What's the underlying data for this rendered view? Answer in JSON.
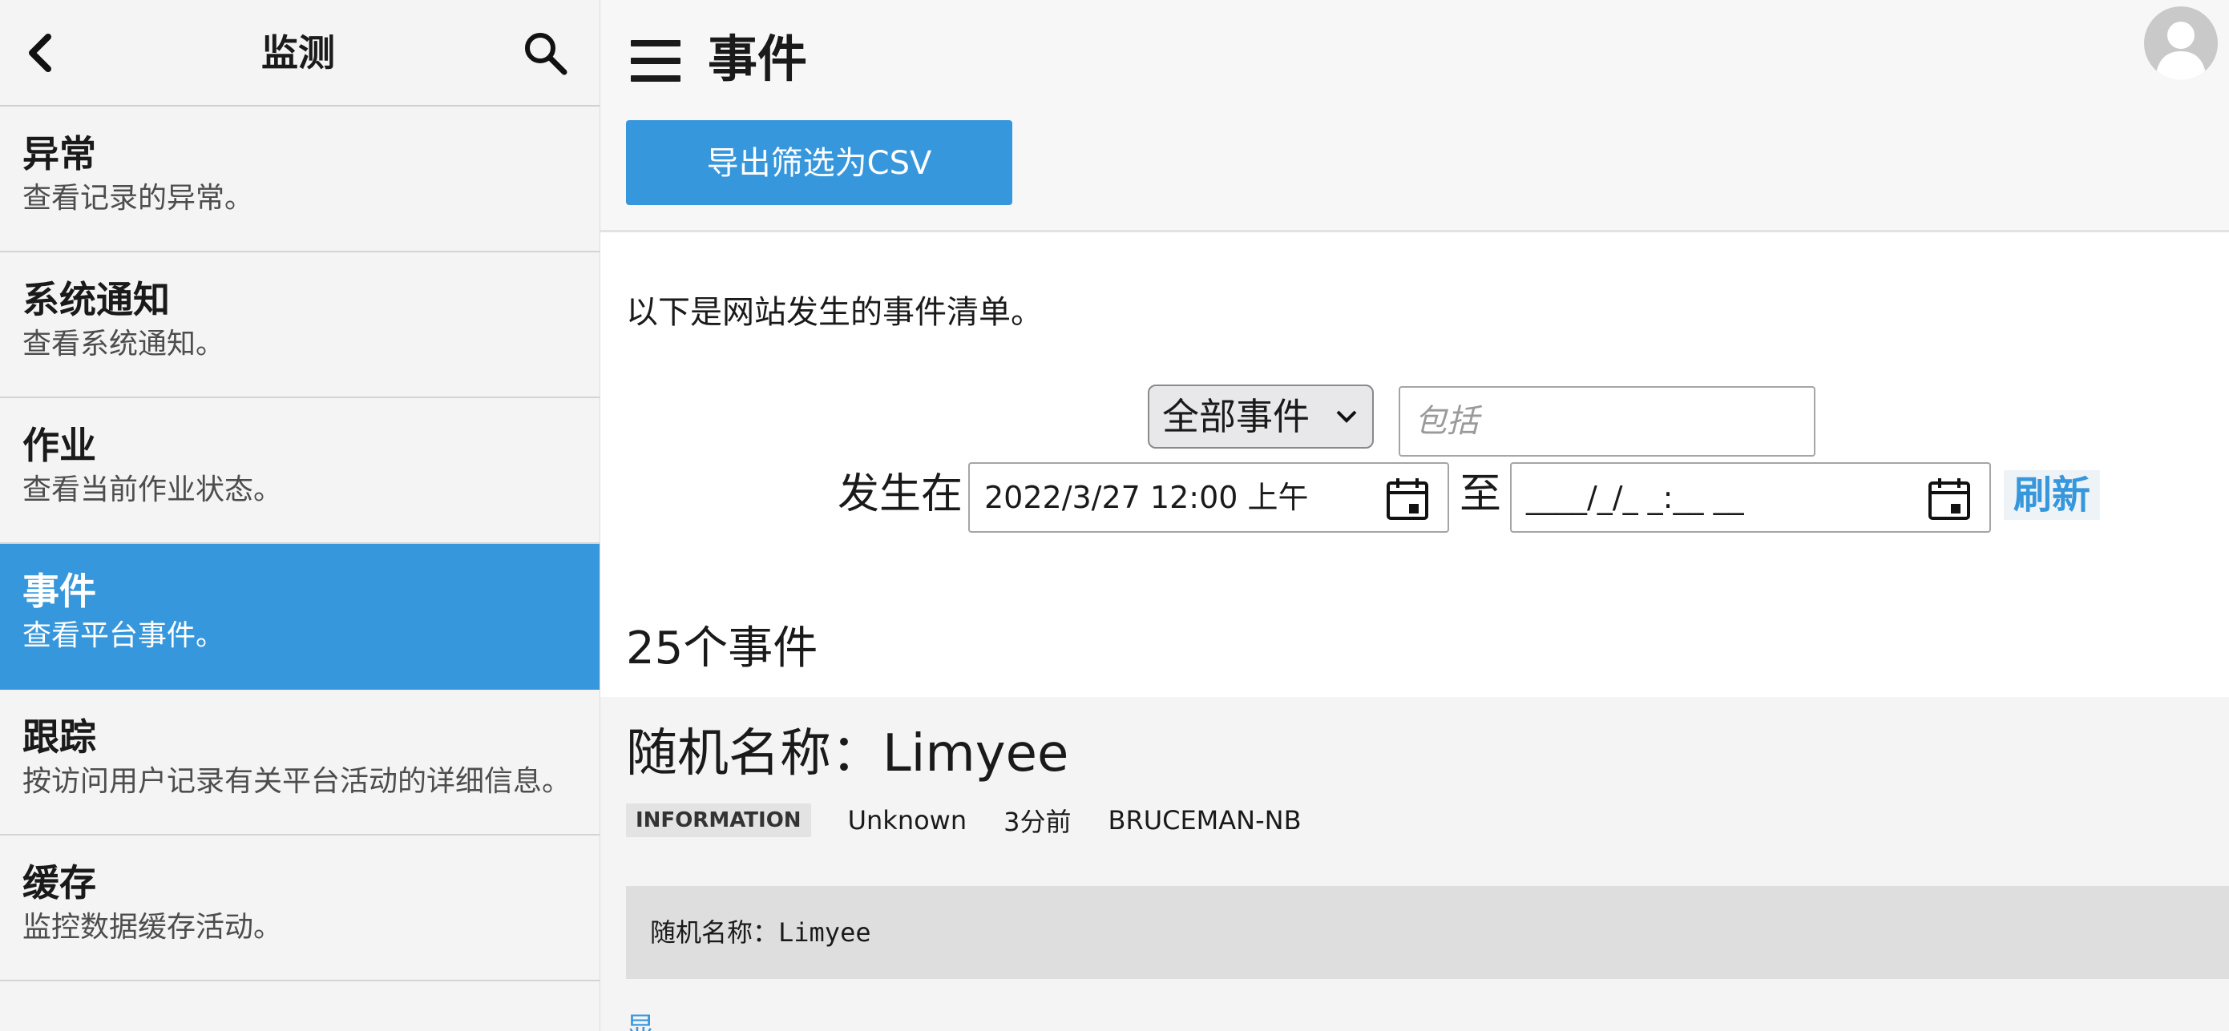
{
  "sidebar": {
    "title": "监测",
    "items": [
      {
        "title": "异常",
        "desc": "查看记录的异常。"
      },
      {
        "title": "系统通知",
        "desc": "查看系统通知。"
      },
      {
        "title": "作业",
        "desc": "查看当前作业状态。"
      },
      {
        "title": "事件",
        "desc": "查看平台事件。",
        "active": true
      },
      {
        "title": "跟踪",
        "desc": "按访问用户记录有关平台活动的详细信息。"
      },
      {
        "title": "缓存",
        "desc": "监控数据缓存活动。"
      }
    ]
  },
  "header": {
    "title": "事件",
    "export_label": "导出筛选为CSV"
  },
  "intro": "以下是网站发生的事件清单。",
  "filters": {
    "event_type": "全部事件",
    "include_placeholder": "包括",
    "occurs_label": "发生在",
    "from_value": "2022/3/27 12:00 上午",
    "to_label": "至",
    "to_value": "____/_/_ _:__ __",
    "refresh_label": "刷新"
  },
  "count_label": "25个事件",
  "event": {
    "title": "随机名称：Limyee",
    "level": "INFORMATION",
    "user": "Unknown",
    "time": "3分前",
    "machine": "BRUCEMAN-NB",
    "body": "随机名称：Limyee"
  },
  "colors": {
    "accent": "#3797dc",
    "sidebar_bg": "#f4f4f4",
    "card_bg": "#f4f4f4"
  }
}
